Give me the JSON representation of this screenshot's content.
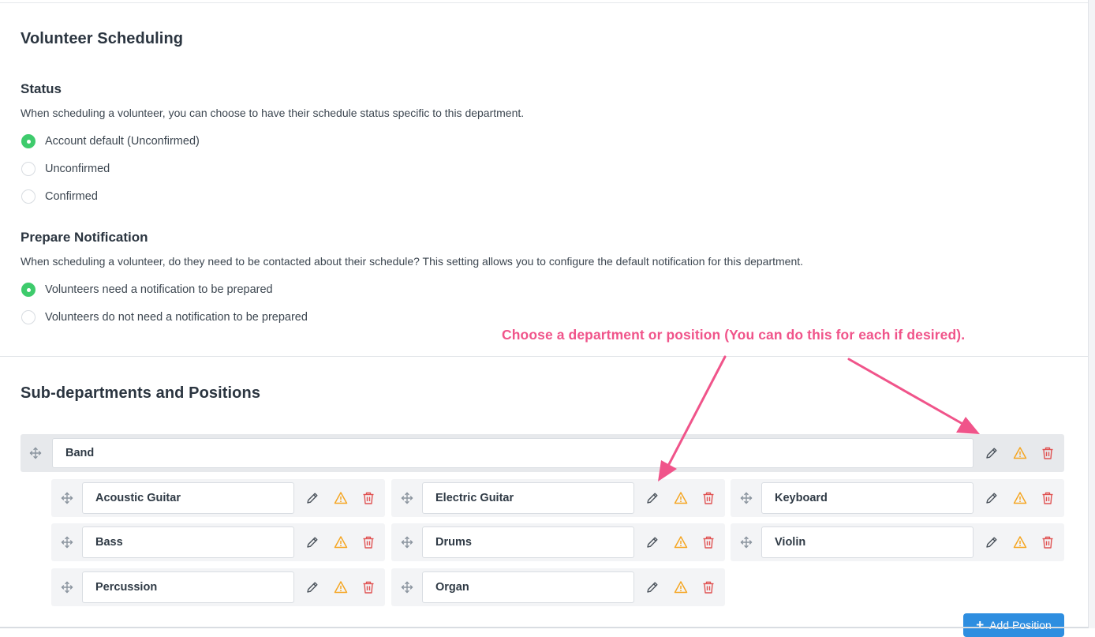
{
  "section_title": "Volunteer Scheduling",
  "status": {
    "title": "Status",
    "description": "When scheduling a volunteer, you can choose to have their schedule status specific to this department.",
    "options": [
      {
        "label": "Account default (Unconfirmed)",
        "selected": true
      },
      {
        "label": "Unconfirmed",
        "selected": false
      },
      {
        "label": "Confirmed",
        "selected": false
      }
    ]
  },
  "prepare_notification": {
    "title": "Prepare Notification",
    "description": "When scheduling a volunteer, do they need to be contacted about their schedule? This setting allows you to configure the default notification for this department.",
    "options": [
      {
        "label": "Volunteers need a notification to be prepared",
        "selected": true
      },
      {
        "label": "Volunteers do not need a notification to be prepared",
        "selected": false
      }
    ]
  },
  "annotation": "Choose a department or position (You can do this for each if desired).",
  "subdepartments": {
    "title": "Sub-departments and Positions",
    "department": {
      "name": "Band"
    },
    "positions": [
      "Acoustic Guitar",
      "Electric Guitar",
      "Keyboard",
      "Bass",
      "Drums",
      "Violin",
      "Percussion",
      "Organ"
    ],
    "add_button": "Add Position"
  },
  "colors": {
    "accent_green": "#3ecb6c",
    "annotation_pink": "#f0548a",
    "warning_orange": "#f5a623",
    "delete_red": "#e05252",
    "button_blue": "#2e8ee0"
  },
  "icons": {
    "drag": "move-icon",
    "edit": "pencil-icon",
    "warning": "warning-icon",
    "delete": "trash-icon",
    "add": "plus-icon"
  }
}
